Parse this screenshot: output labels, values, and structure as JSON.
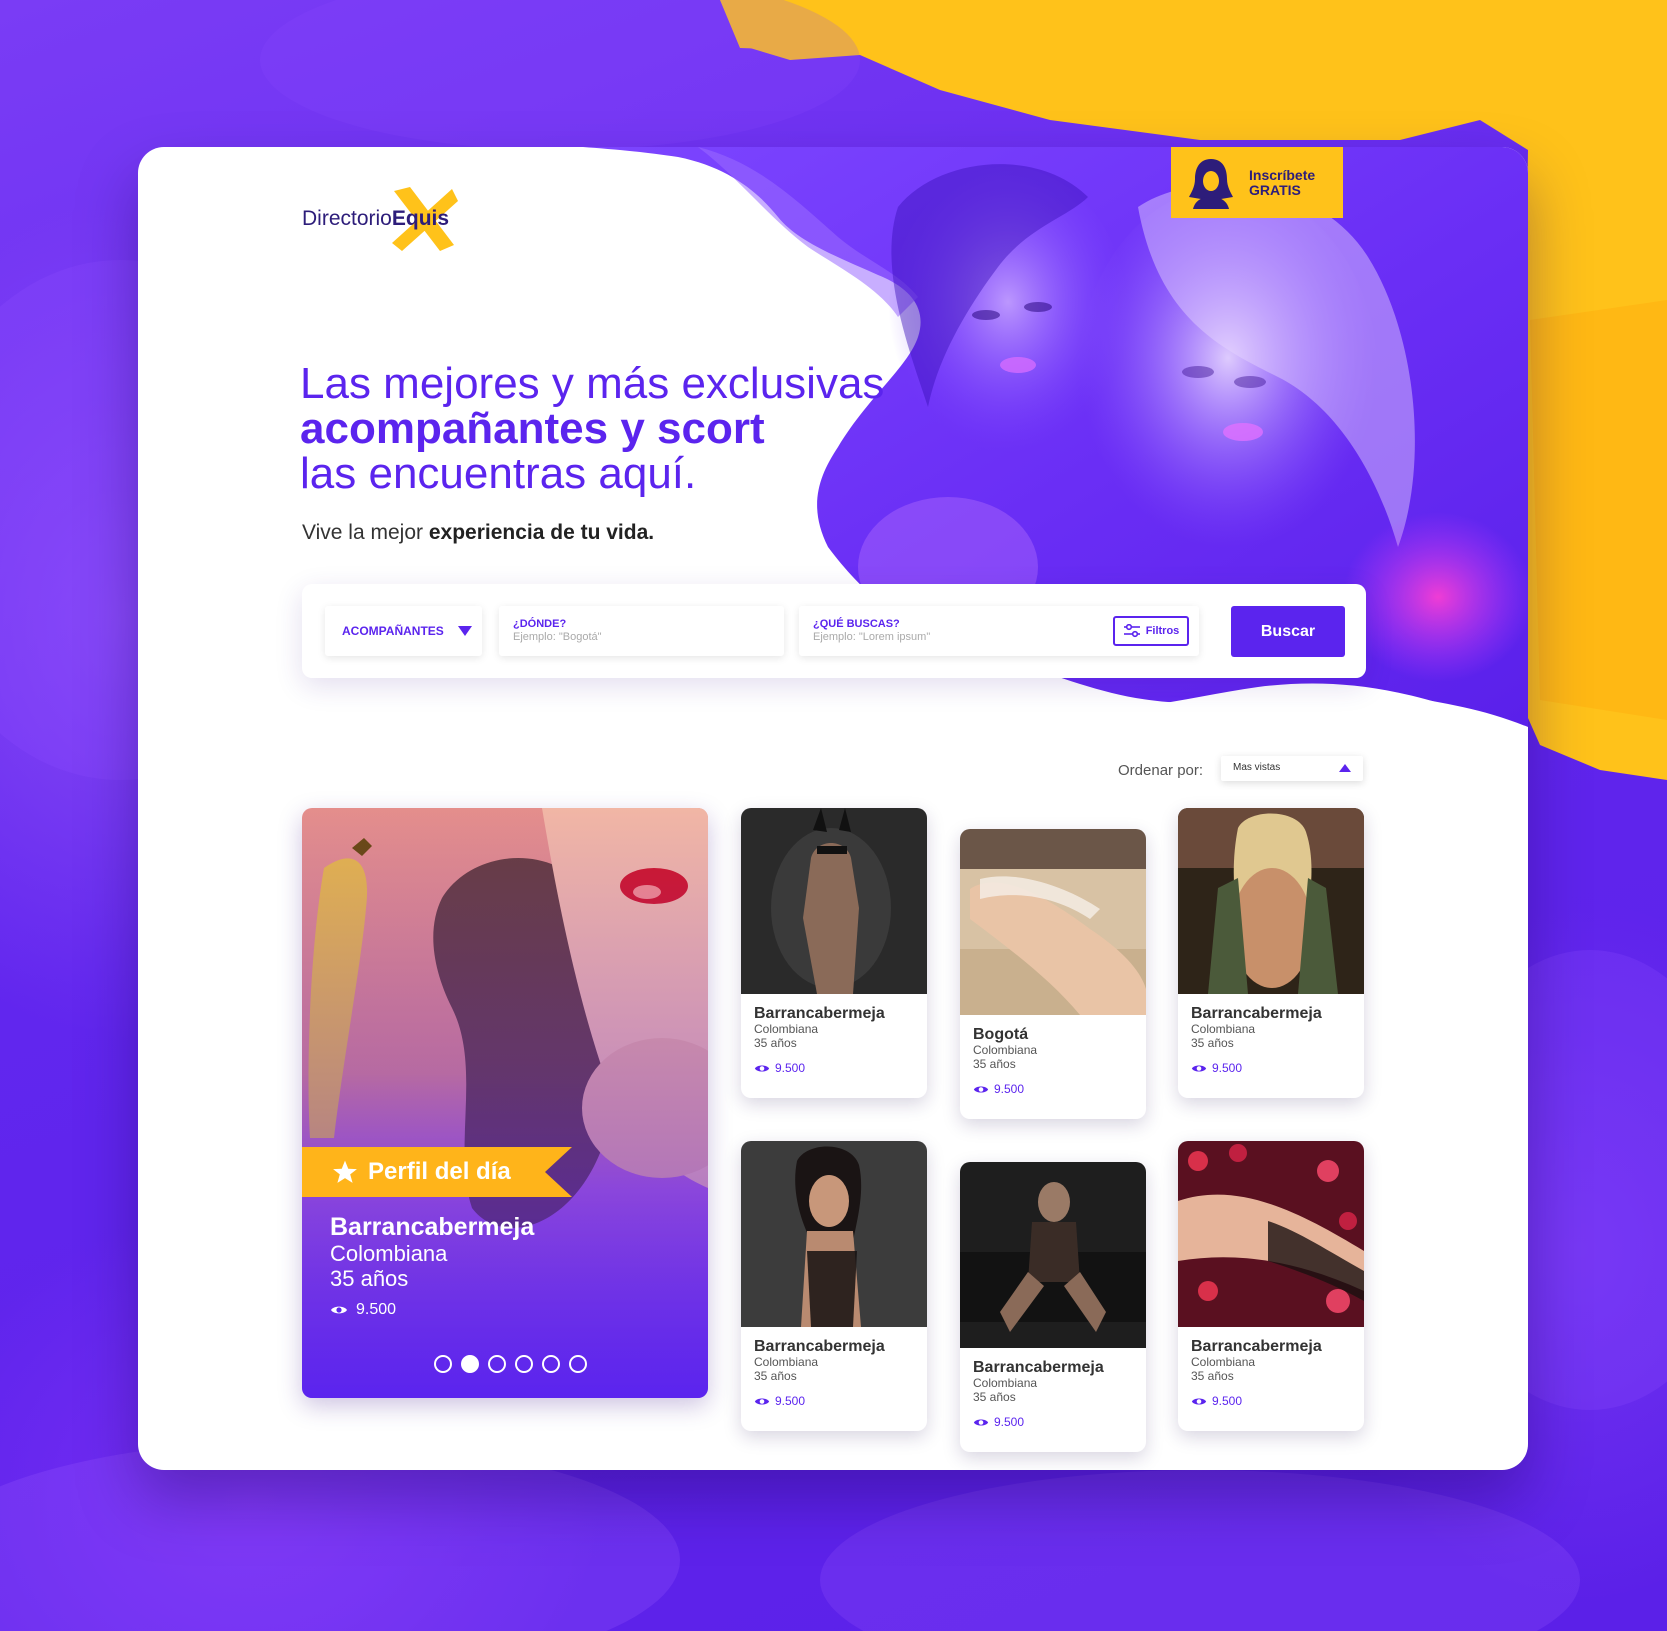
{
  "brand": {
    "logo_prefix": "Directorio",
    "logo_bold": "Equis",
    "accent": "#5b24ee",
    "yellow": "#ffc21a"
  },
  "signup": {
    "line1": "Inscríbete",
    "line2": "GRATIS",
    "icon": "woman-avatar-icon"
  },
  "hero": {
    "line1": "Las mejores y más exclusivas",
    "line2": "acompañantes y scort",
    "line3": "las encuentras aquí.",
    "sub_plain": "Vive la mejor ",
    "sub_bold": "experiencia de tu vida."
  },
  "search": {
    "category": "ACOMPAÑANTES",
    "where_label": "¿DÓNDE?",
    "where_placeholder": "Ejemplo: \"Bogotá\"",
    "what_label": "¿QUÉ BUSCAS?",
    "what_placeholder": "Ejemplo: \"Lorem ipsum\"",
    "filters_label": "Filtros",
    "button": "Buscar"
  },
  "sort": {
    "label": "Ordenar por:",
    "selected": "Mas vistas"
  },
  "featured": {
    "badge": "Perfil del día",
    "city": "Barrancabermeja",
    "nationality": "Colombiana",
    "age": "35 años",
    "views": "9.500",
    "dots_total": 6,
    "dot_active": 2
  },
  "profiles": [
    {
      "city": "Barrancabermeja",
      "nationality": "Colombiana",
      "age": "35 años",
      "views": "9.500"
    },
    {
      "city": "Bogotá",
      "nationality": "Colombiana",
      "age": "35 años",
      "views": "9.500"
    },
    {
      "city": "Barrancabermeja",
      "nationality": "Colombiana",
      "age": "35 años",
      "views": "9.500"
    },
    {
      "city": "Barrancabermeja",
      "nationality": "Colombiana",
      "age": "35 años",
      "views": "9.500"
    },
    {
      "city": "Barrancabermeja",
      "nationality": "Colombiana",
      "age": "35 años",
      "views": "9.500"
    },
    {
      "city": "Barrancabermeja",
      "nationality": "Colombiana",
      "age": "35 años",
      "views": "9.500"
    }
  ]
}
